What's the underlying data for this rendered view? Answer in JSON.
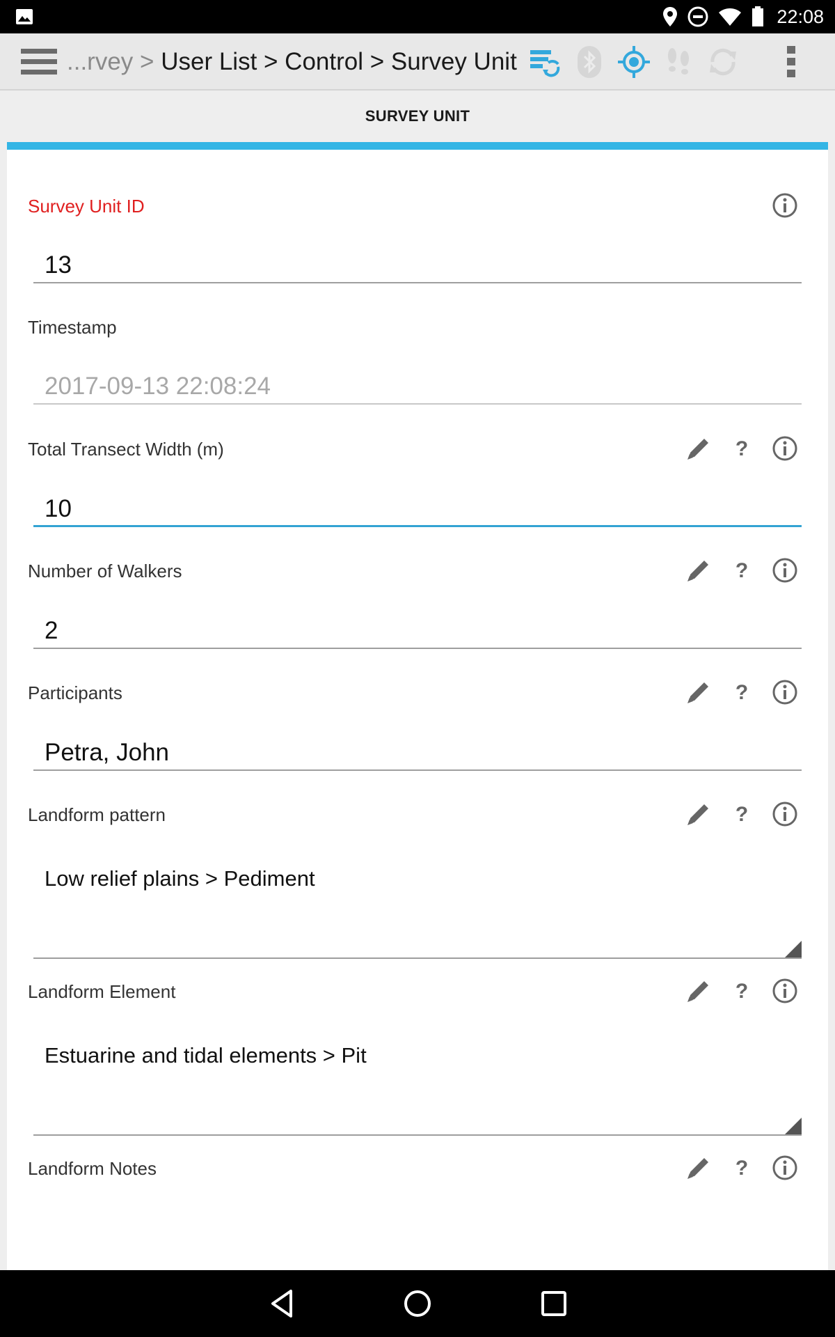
{
  "status_bar": {
    "time": "22:08",
    "icons": [
      "image-icon",
      "location-icon",
      "do-not-disturb-icon",
      "wifi-icon",
      "battery-icon"
    ]
  },
  "toolbar": {
    "breadcrumb_prefix": "...rvey >",
    "breadcrumb_path": "User List > Control > Survey Unit",
    "icons": [
      "menu-icon",
      "sync-server-icon",
      "bluetooth-icon",
      "gps-icon",
      "tracker-icon",
      "sync-icon",
      "overflow-menu-icon"
    ]
  },
  "tab": {
    "title": "SURVEY UNIT"
  },
  "fields": {
    "survey_unit_id": {
      "label": "Survey Unit ID",
      "value": "13"
    },
    "timestamp": {
      "label": "Timestamp",
      "value": "2017-09-13 22:08:24"
    },
    "transect_width": {
      "label": "Total Transect Width (m)",
      "value": "10"
    },
    "walkers": {
      "label": "Number of Walkers",
      "value": "2"
    },
    "participants": {
      "label": "Participants",
      "value": "Petra, John"
    },
    "landform_pattern": {
      "label": "Landform pattern",
      "value": "Low relief plains > Pediment"
    },
    "landform_element": {
      "label": "Landform Element",
      "value": "Estuarine and tidal elements > Pit"
    },
    "landform_notes": {
      "label": "Landform Notes"
    }
  },
  "colors": {
    "accent": "#33b5e5",
    "required_label": "#e02020",
    "toolbar_bg": "#e8e8e8"
  }
}
